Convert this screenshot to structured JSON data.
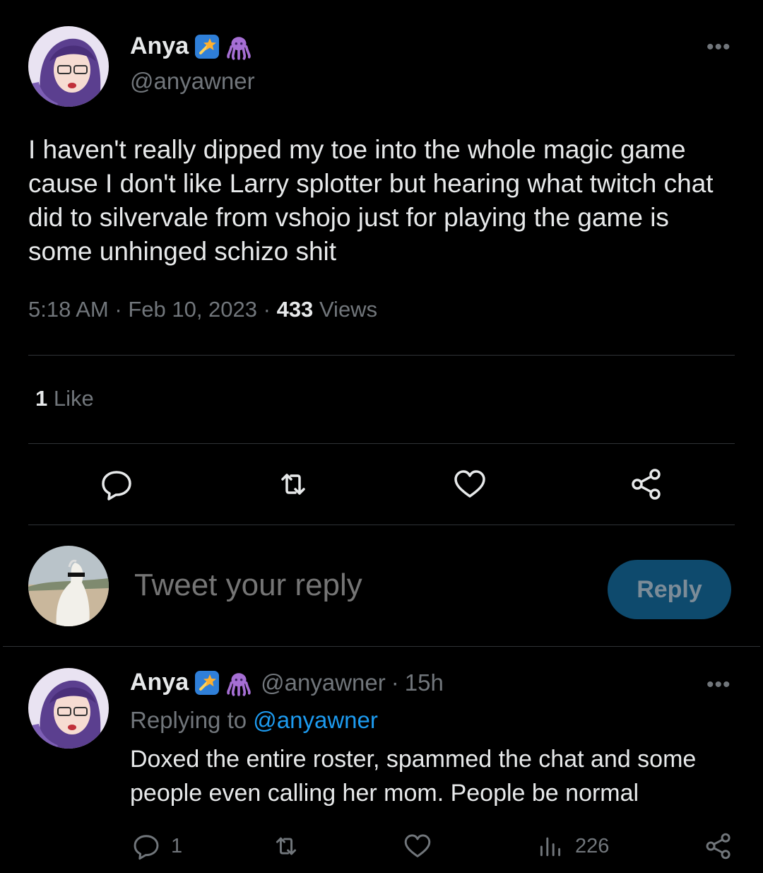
{
  "tweet": {
    "author": {
      "display_name": "Anya",
      "handle": "@anyawner",
      "badges": [
        "verified-star-badge-icon",
        "octopus-emoji-icon"
      ]
    },
    "text": "I haven't really dipped my toe into the whole magic game cause I don't like Larry splotter but hearing what twitch chat did to silvervale from vshojo just for playing the game is some unhinged schizo shit",
    "time": "5:18 AM",
    "date": "Feb 10, 2023",
    "views_count": "433",
    "views_label": "Views",
    "likes_count": "1",
    "likes_label": "Like",
    "actions": [
      "reply-icon",
      "retweet-icon",
      "like-icon",
      "share-icon"
    ],
    "more_label": "•••"
  },
  "composer": {
    "placeholder": "Tweet your reply",
    "button_label": "Reply"
  },
  "reply": {
    "author": {
      "display_name": "Anya",
      "handle": "@anyawner"
    },
    "time_ago": "15h",
    "separator": "·",
    "replying_prefix": "Replying to",
    "replying_to": "@anyawner",
    "text": "Doxed the entire roster, spammed the chat and some people even calling her mom.  People be normal",
    "reply_count": "1",
    "views_count": "226",
    "more_label": "•••"
  },
  "colors": {
    "background": "#000000",
    "text_primary": "#e7e9ea",
    "text_secondary": "#71767b",
    "link": "#1d9bf0",
    "reply_button_bg": "#0e4a6d",
    "divider": "#2f3336"
  }
}
